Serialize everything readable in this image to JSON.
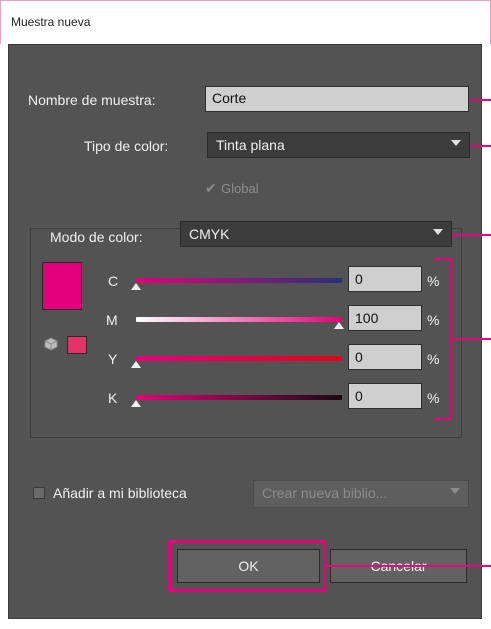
{
  "window": {
    "title": "Muestra nueva"
  },
  "form": {
    "name_label": "Nombre de muestra:",
    "name_value": "Corte",
    "type_label": "Tipo de color:",
    "type_value": "Tinta plana",
    "global_label": "Global",
    "global_checked": true,
    "mode_label": "Modo de color:",
    "mode_value": "CMYK"
  },
  "color": {
    "swatch_hex": "#e4007c"
  },
  "sliders": [
    {
      "label": "C",
      "value": "0",
      "unit": "%"
    },
    {
      "label": "M",
      "value": "100",
      "unit": "%"
    },
    {
      "label": "Y",
      "value": "0",
      "unit": "%"
    },
    {
      "label": "K",
      "value": "0",
      "unit": "%"
    }
  ],
  "library": {
    "checkbox_label": "Añadir a mi biblioteca",
    "dropdown_value": "Crear nueva biblio...",
    "checked": false
  },
  "buttons": {
    "ok": "OK",
    "cancel": "Cancelar"
  },
  "accent_color": "#e8007f"
}
